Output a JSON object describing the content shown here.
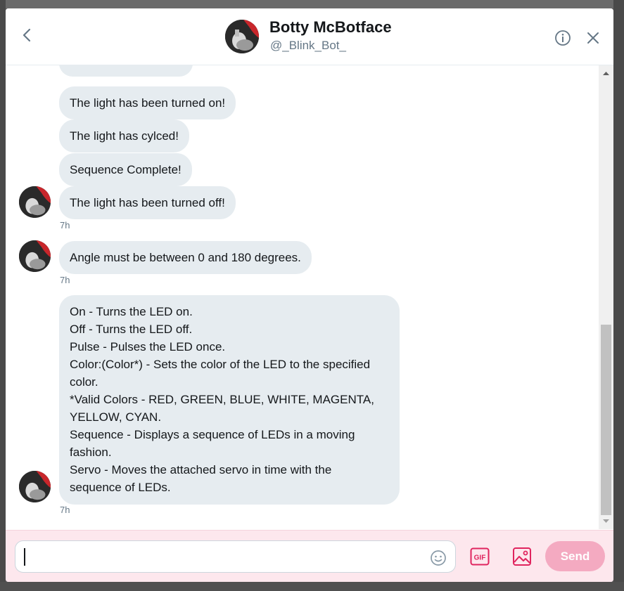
{
  "header": {
    "title": "Botty McBotface",
    "handle": "@_Blink_Bot_"
  },
  "messages": [
    {
      "text": "The light has been turned on!"
    },
    {
      "text": "The light has cylced!"
    },
    {
      "text": "Sequence Complete!"
    },
    {
      "text": "The light has been turned off!"
    },
    {
      "timestamp": "7h"
    },
    {
      "text": "Angle must be between 0 and 180 degrees."
    },
    {
      "timestamp": "7h"
    },
    {
      "lines": [
        "On - Turns the LED on.",
        "Off - Turns the LED off.",
        "Pulse - Pulses the LED once.",
        "Color:(Color*) - Sets the color of the LED to the specified",
        "color.",
        "*Valid Colors - RED, GREEN, BLUE, WHITE, MAGENTA,",
        "YELLOW, CYAN.",
        "Sequence - Displays a sequence of LEDs in a moving",
        "fashion.",
        "Servo - Moves the attached servo in time with the",
        "sequence of LEDs."
      ]
    },
    {
      "timestamp": "7h"
    }
  ],
  "composer": {
    "input_value": "",
    "gif_label": "GIF",
    "send_label": "Send"
  },
  "colors": {
    "accent": "#e0245e",
    "send_disabled": "#f4aac1",
    "bubble": "#e6ecf0",
    "composer_bg": "#fde7ed"
  },
  "icons": [
    "back-arrow-icon",
    "info-icon",
    "close-icon",
    "emoji-icon",
    "gif-icon",
    "image-icon"
  ]
}
